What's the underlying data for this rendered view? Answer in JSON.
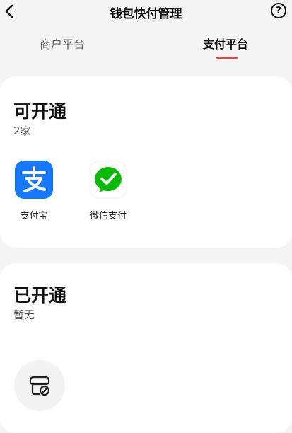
{
  "header": {
    "title": "钱包快付管理",
    "back_icon": "chevron-left-icon",
    "help_icon": "help-circle-icon",
    "help_glyph": "?"
  },
  "tabs": [
    {
      "label": "商户平台",
      "active": false
    },
    {
      "label": "支付平台",
      "active": true
    }
  ],
  "accent_color": "#e8433d",
  "available": {
    "title": "可开通",
    "count": "2家",
    "apps": [
      {
        "label": "支付宝",
        "icon": "alipay-icon",
        "color": "#1677ff"
      },
      {
        "label": "微信支付",
        "icon": "wechat-pay-icon",
        "color": "#09bb07"
      }
    ]
  },
  "enabled": {
    "title": "已开通",
    "status": "暂无",
    "empty_icon": "empty-card-icon"
  }
}
